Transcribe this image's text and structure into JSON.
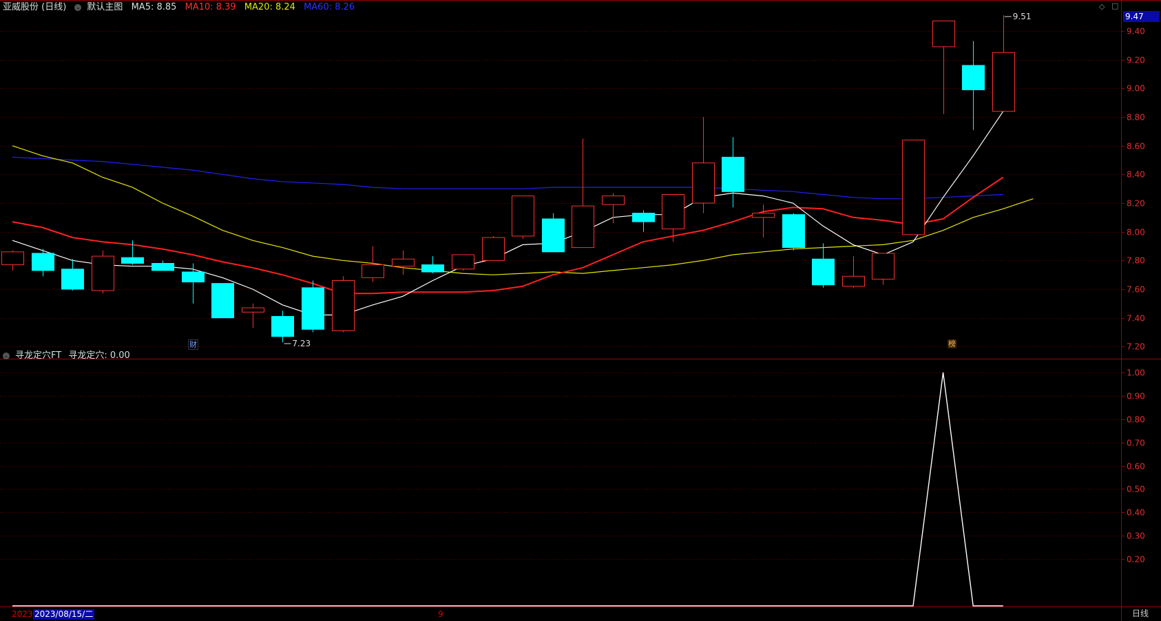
{
  "header": {
    "stock_title": "亚威股份 (日线)",
    "main_chart_label": "默认主图",
    "ma5": "MA5: 8.85",
    "ma10": "MA10: 8.39",
    "ma20": "MA20: 8.24",
    "ma60": "MA60: 8.26",
    "ma5_color": "#ffffff",
    "ma10_color": "#ff2020",
    "ma20_color": "#e8e800",
    "ma60_color": "#2020ff"
  },
  "sub_header": {
    "indicator_name": "寻龙定穴FT",
    "indicator_value": "寻龙定穴: 0.00"
  },
  "current_price_label": "9.47",
  "timeline": {
    "year_label": "2023",
    "date_label": "2023/08/15/二",
    "month_label": "9",
    "period_label": "日线"
  },
  "markers": {
    "finance": "财",
    "rank": "榜"
  },
  "colors": {
    "up": "#ff3030",
    "down": "#00ffff",
    "grid": "#7a0000",
    "axis": "#a00000",
    "indicator_line": "#ffffff"
  },
  "chart_data": [
    {
      "type": "candlestick",
      "ylim": [
        7.12,
        9.52
      ],
      "yticks": [
        "9.40",
        "9.20",
        "9.00",
        "8.80",
        "8.60",
        "8.40",
        "8.20",
        "8.00",
        "7.80",
        "7.60",
        "7.40",
        "7.20"
      ],
      "candles": [
        {
          "o": 7.77,
          "h": 7.87,
          "l": 7.73,
          "c": 7.86
        },
        {
          "o": 7.85,
          "h": 7.88,
          "l": 7.69,
          "c": 7.73
        },
        {
          "o": 7.74,
          "h": 7.81,
          "l": 7.59,
          "c": 7.6
        },
        {
          "o": 7.59,
          "h": 7.87,
          "l": 7.57,
          "c": 7.83
        },
        {
          "o": 7.82,
          "h": 7.94,
          "l": 7.77,
          "c": 7.78
        },
        {
          "o": 7.78,
          "h": 7.8,
          "l": 7.73,
          "c": 7.73
        },
        {
          "o": 7.72,
          "h": 7.78,
          "l": 7.5,
          "c": 7.65
        },
        {
          "o": 7.64,
          "h": 7.64,
          "l": 7.4,
          "c": 7.4
        },
        {
          "o": 7.44,
          "h": 7.5,
          "l": 7.33,
          "c": 7.47
        },
        {
          "o": 7.41,
          "h": 7.45,
          "l": 7.23,
          "c": 7.27
        },
        {
          "o": 7.61,
          "h": 7.66,
          "l": 7.3,
          "c": 7.32
        },
        {
          "o": 7.31,
          "h": 7.69,
          "l": 7.3,
          "c": 7.66
        },
        {
          "o": 7.68,
          "h": 7.9,
          "l": 7.65,
          "c": 7.77
        },
        {
          "o": 7.76,
          "h": 7.87,
          "l": 7.7,
          "c": 7.81
        },
        {
          "o": 7.77,
          "h": 7.83,
          "l": 7.71,
          "c": 7.72
        },
        {
          "o": 7.74,
          "h": 7.84,
          "l": 7.73,
          "c": 7.84
        },
        {
          "o": 7.8,
          "h": 7.97,
          "l": 7.8,
          "c": 7.96
        },
        {
          "o": 7.97,
          "h": 8.25,
          "l": 7.95,
          "c": 8.25
        },
        {
          "o": 8.09,
          "h": 8.13,
          "l": 7.86,
          "c": 7.86
        },
        {
          "o": 7.89,
          "h": 8.65,
          "l": 7.89,
          "c": 8.18
        },
        {
          "o": 8.19,
          "h": 8.27,
          "l": 8.06,
          "c": 8.25
        },
        {
          "o": 8.13,
          "h": 8.15,
          "l": 8.0,
          "c": 8.07
        },
        {
          "o": 8.02,
          "h": 8.26,
          "l": 7.93,
          "c": 8.26
        },
        {
          "o": 8.2,
          "h": 8.8,
          "l": 8.13,
          "c": 8.48
        },
        {
          "o": 8.52,
          "h": 8.66,
          "l": 8.17,
          "c": 8.28
        },
        {
          "o": 8.1,
          "h": 8.19,
          "l": 7.96,
          "c": 8.13
        },
        {
          "o": 8.12,
          "h": 8.13,
          "l": 7.87,
          "c": 7.89
        },
        {
          "o": 7.81,
          "h": 7.92,
          "l": 7.61,
          "c": 7.63
        },
        {
          "o": 7.62,
          "h": 7.83,
          "l": 7.61,
          "c": 7.69
        },
        {
          "o": 7.67,
          "h": 7.85,
          "l": 7.63,
          "c": 7.85
        },
        {
          "o": 7.98,
          "h": 8.64,
          "l": 7.98,
          "c": 8.64
        },
        {
          "o": 9.29,
          "h": 9.47,
          "l": 8.82,
          "c": 9.47
        },
        {
          "o": 9.16,
          "h": 9.33,
          "l": 8.71,
          "c": 8.99
        },
        {
          "o": 8.84,
          "h": 9.51,
          "l": 8.84,
          "c": 9.25
        }
      ],
      "ma5": [
        7.94,
        7.87,
        7.8,
        7.77,
        7.76,
        7.76,
        7.74,
        7.68,
        7.6,
        7.49,
        7.42,
        7.42,
        7.49,
        7.55,
        7.66,
        7.76,
        7.81,
        7.91,
        7.92,
        8.0,
        8.1,
        8.12,
        8.12,
        8.24,
        8.27,
        8.25,
        8.2,
        8.04,
        7.91,
        7.84,
        7.93,
        8.24,
        8.53,
        8.84
      ],
      "ma10": [
        8.07,
        8.03,
        7.96,
        7.93,
        7.91,
        7.88,
        7.84,
        7.79,
        7.75,
        7.7,
        7.64,
        7.57,
        7.57,
        7.58,
        7.58,
        7.58,
        7.59,
        7.62,
        7.7,
        7.75,
        7.84,
        7.93,
        7.97,
        8.01,
        8.07,
        8.14,
        8.17,
        8.16,
        8.1,
        8.08,
        8.05,
        8.09,
        8.24,
        8.38
      ],
      "ma20": [
        8.6,
        8.53,
        8.48,
        8.38,
        8.31,
        8.2,
        8.11,
        8.01,
        7.94,
        7.89,
        7.83,
        7.8,
        7.78,
        7.75,
        7.73,
        7.71,
        7.7,
        7.71,
        7.72,
        7.71,
        7.73,
        7.75,
        7.77,
        7.8,
        7.84,
        7.86,
        7.88,
        7.89,
        7.9,
        7.91,
        7.94,
        8.01,
        8.1,
        8.16,
        8.23
      ],
      "ma60": [
        8.52,
        8.51,
        8.5,
        8.49,
        8.47,
        8.45,
        8.43,
        8.4,
        8.37,
        8.35,
        8.34,
        8.33,
        8.31,
        8.3,
        8.3,
        8.3,
        8.3,
        8.3,
        8.31,
        8.31,
        8.31,
        8.31,
        8.31,
        8.31,
        8.3,
        8.29,
        8.28,
        8.26,
        8.24,
        8.23,
        8.23,
        8.24,
        8.25,
        8.26
      ],
      "annotations": [
        {
          "text": "7.23",
          "candle": 9,
          "value": 7.23
        },
        {
          "text": "9.51",
          "candle": 33,
          "value": 9.51
        }
      ]
    },
    {
      "type": "line",
      "name": "寻龙定穴",
      "ylim": [
        0,
        1.05
      ],
      "yticks": [
        "1.00",
        "0.90",
        "0.80",
        "0.70",
        "0.60",
        "0.50",
        "0.40",
        "0.30",
        "0.20"
      ],
      "values": [
        0,
        0,
        0,
        0,
        0,
        0,
        0,
        0,
        0,
        0,
        0,
        0,
        0,
        0,
        0,
        0,
        0,
        0,
        0,
        0,
        0,
        0,
        0,
        0,
        0,
        0,
        0,
        0,
        0,
        0,
        0,
        1,
        0,
        0
      ]
    }
  ]
}
